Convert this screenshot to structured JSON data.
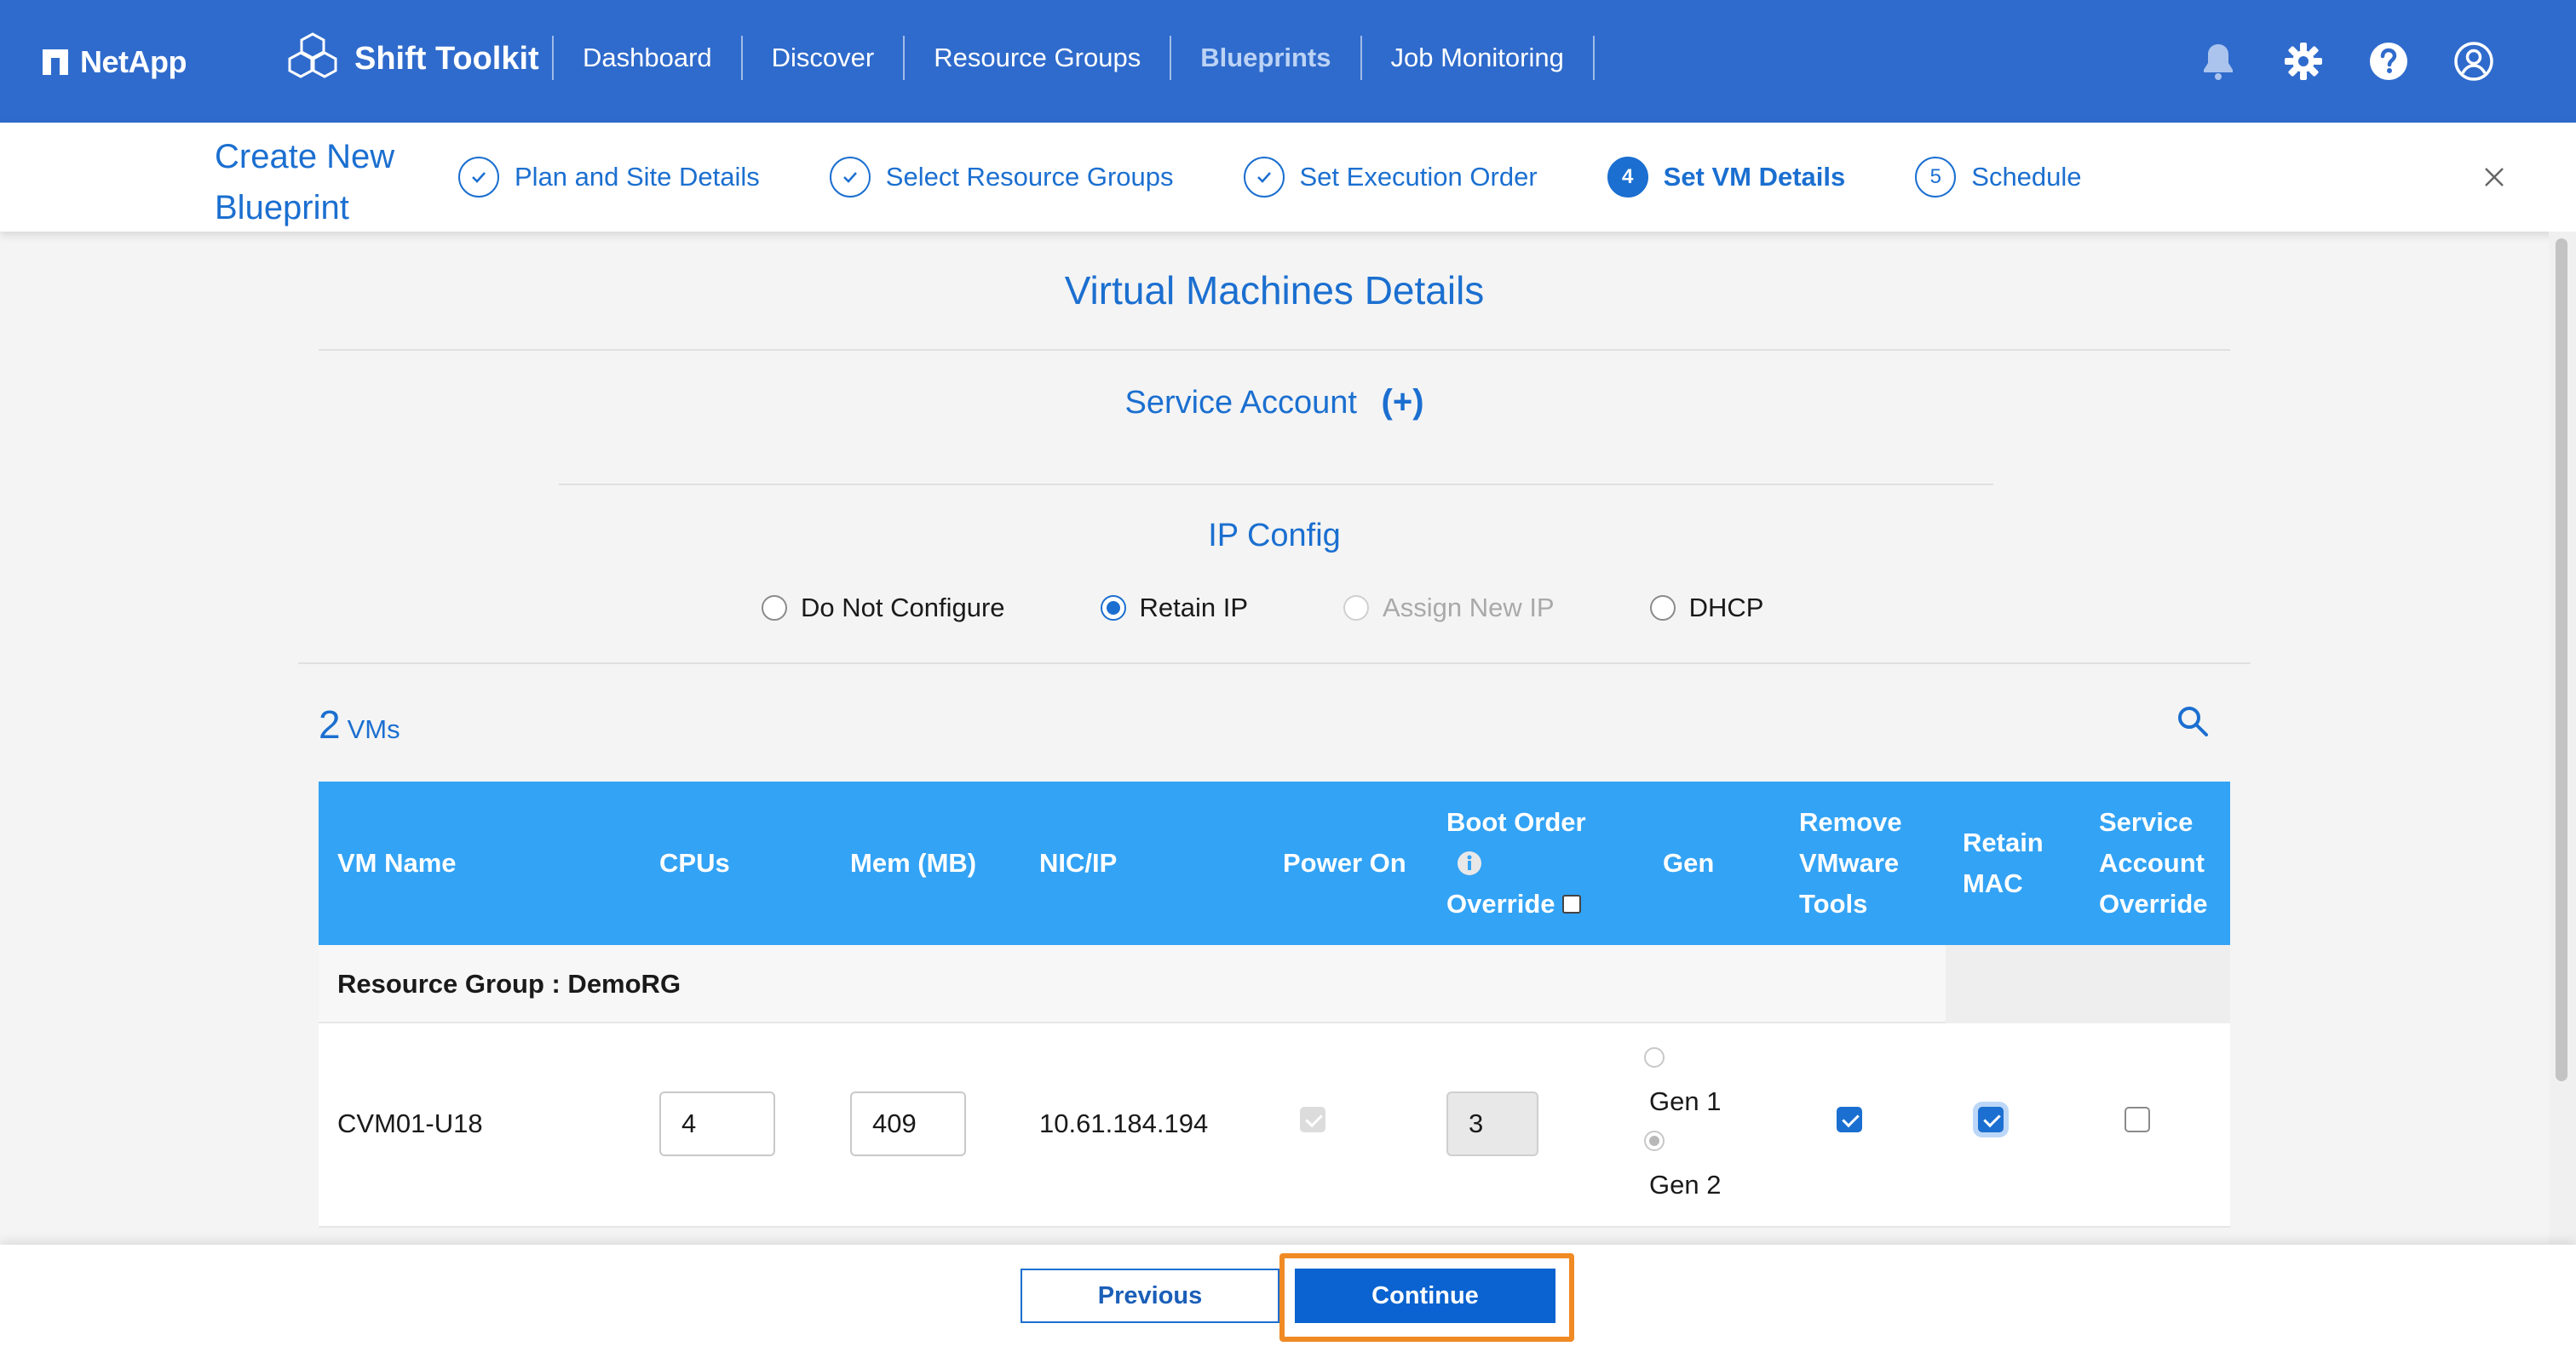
{
  "brand": {
    "company": "NetApp",
    "product": "Shift Toolkit"
  },
  "nav": {
    "items": [
      {
        "label": "Dashboard",
        "active": false
      },
      {
        "label": "Discover",
        "active": false
      },
      {
        "label": "Resource Groups",
        "active": false
      },
      {
        "label": "Blueprints",
        "active": true
      },
      {
        "label": "Job Monitoring",
        "active": false
      }
    ],
    "icons": [
      "bell-icon",
      "gear-icon",
      "help-icon",
      "user-icon"
    ]
  },
  "wizard": {
    "title": "Create New Blueprint",
    "steps": [
      {
        "label": "Plan and Site Details",
        "state": "done",
        "marker": ""
      },
      {
        "label": "Select Resource Groups",
        "state": "done",
        "marker": ""
      },
      {
        "label": "Set Execution Order",
        "state": "done",
        "marker": ""
      },
      {
        "label": "Set VM Details",
        "state": "current",
        "marker": "4"
      },
      {
        "label": "Schedule",
        "state": "pending",
        "marker": "5"
      }
    ]
  },
  "main": {
    "heading": "Virtual Machines Details",
    "service_account_label": "Service Account",
    "service_account_plus": "(+)",
    "ip_config": {
      "heading": "IP Config",
      "options": [
        {
          "label": "Do Not Configure",
          "checked": false,
          "disabled": false
        },
        {
          "label": "Retain IP",
          "checked": true,
          "disabled": false
        },
        {
          "label": "Assign New IP",
          "checked": false,
          "disabled": true
        },
        {
          "label": "DHCP",
          "checked": false,
          "disabled": false
        }
      ]
    },
    "vm_count": "2",
    "vm_count_label": "VMs"
  },
  "table": {
    "headers": {
      "vm_name": "VM Name",
      "cpus": "CPUs",
      "mem": "Mem (MB)",
      "nic": "NIC/IP",
      "power_on": "Power On",
      "boot_order_1": "Boot Order",
      "boot_order_2": "Override",
      "gen": "Gen",
      "remove_tools_1": "Remove",
      "remove_tools_2": "VMware",
      "remove_tools_3": "Tools",
      "retain_mac_1": "Retain",
      "retain_mac_2": "MAC",
      "sa_override_1": "Service",
      "sa_override_2": "Account",
      "sa_override_3": "Override"
    },
    "boot_order_override_checked": false,
    "resource_group_label": "Resource Group : DemoRG",
    "rows": [
      {
        "vm_name": "CVM01-U18",
        "cpus": "4",
        "mem": "409",
        "nic_ip": "10.61.184.194",
        "power_on": true,
        "boot_order": "3",
        "gen_1_label": "Gen 1",
        "gen_2_label": "Gen 2",
        "gen_selected": "Gen 2",
        "remove_vmware_tools": true,
        "retain_mac": true,
        "service_account_override": false
      }
    ]
  },
  "footer": {
    "previous_label": "Previous",
    "continue_label": "Continue"
  },
  "colors": {
    "topbar": "#2f6bcc",
    "accent": "#1b6fd0",
    "table_header": "#33a3f5",
    "highlight": "#f08a24"
  }
}
